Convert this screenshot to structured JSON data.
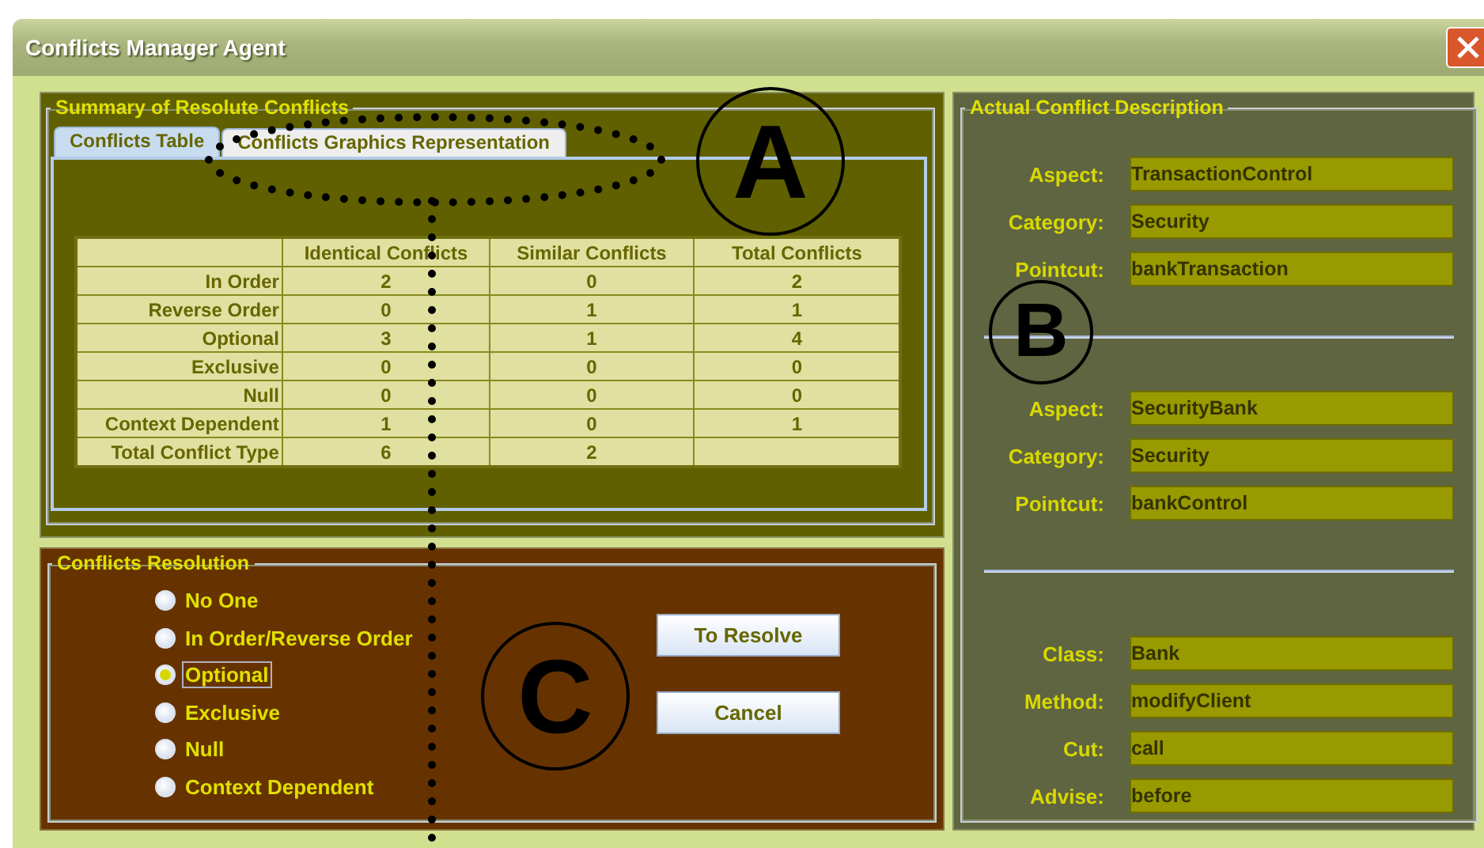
{
  "window": {
    "title": "Conflicts Manager Agent"
  },
  "summary": {
    "title": "Summary of Resolute Conflicts",
    "tabs": [
      {
        "label": "Conflicts Table",
        "selected": true
      },
      {
        "label": "Conflicts Graphics Representation",
        "selected": false
      }
    ],
    "table": {
      "columns": [
        "Identical Conflicts",
        "Similar Conflicts",
        "Total Conflicts"
      ],
      "rows": [
        {
          "label": "In Order",
          "cells": [
            "2",
            "0",
            "2"
          ]
        },
        {
          "label": "Reverse Order",
          "cells": [
            "0",
            "1",
            "1"
          ]
        },
        {
          "label": "Optional",
          "cells": [
            "3",
            "1",
            "4"
          ]
        },
        {
          "label": "Exclusive",
          "cells": [
            "0",
            "0",
            "0"
          ]
        },
        {
          "label": "Null",
          "cells": [
            "0",
            "0",
            "0"
          ]
        },
        {
          "label": "Context Dependent",
          "cells": [
            "1",
            "0",
            "1"
          ]
        },
        {
          "label": "Total Conflict Type",
          "cells": [
            "6",
            "2"
          ]
        }
      ]
    }
  },
  "resolution": {
    "title": "Conflicts Resolution",
    "options": [
      {
        "label": "No One",
        "selected": false
      },
      {
        "label": "In Order/Reverse Order",
        "selected": false
      },
      {
        "label": "Optional",
        "selected": true
      },
      {
        "label": "Exclusive",
        "selected": false
      },
      {
        "label": "Null",
        "selected": false
      },
      {
        "label": "Context Dependent",
        "selected": false
      }
    ],
    "buttons": [
      "To Resolve",
      "Cancel"
    ]
  },
  "description": {
    "title": "Actual Conflict Description",
    "groups": [
      [
        {
          "label": "Aspect:",
          "value": "TransactionControl"
        },
        {
          "label": "Category:",
          "value": "Security"
        },
        {
          "label": "Pointcut:",
          "value": "bankTransaction"
        }
      ],
      [
        {
          "label": "Aspect:",
          "value": "SecurityBank"
        },
        {
          "label": "Category:",
          "value": "Security"
        },
        {
          "label": "Pointcut:",
          "value": "bankControl"
        }
      ],
      [
        {
          "label": "Class:",
          "value": "Bank"
        },
        {
          "label": "Method:",
          "value": "modifyClient"
        },
        {
          "label": "Cut:",
          "value": "call"
        },
        {
          "label": "Advise:",
          "value": "before"
        }
      ]
    ]
  },
  "annotations": [
    {
      "label": "A"
    },
    {
      "label": "B"
    },
    {
      "label": "C"
    }
  ]
}
